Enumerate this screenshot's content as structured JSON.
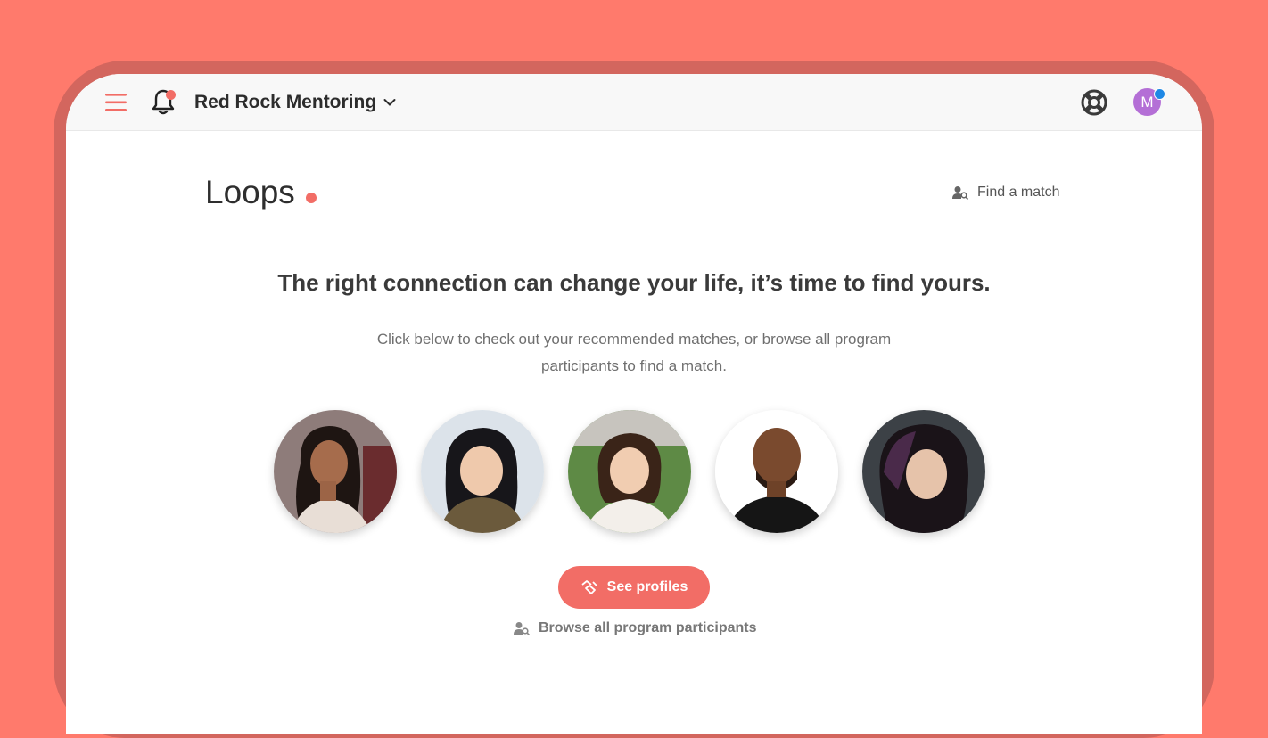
{
  "header": {
    "org_name": "Red Rock Mentoring",
    "avatar_initial": "M"
  },
  "page": {
    "title": "Loops",
    "find_match_label": "Find a match"
  },
  "hero": {
    "headline": "The right connection can change your life, it’s time to find yours.",
    "subtext": "Click below to check out your recommended matches, or browse all program participants to find a match."
  },
  "actions": {
    "see_profiles_label": "See profiles",
    "browse_label": "Browse all program participants"
  },
  "colors": {
    "background": "#FF7A6C",
    "device_frame": "#D3665E",
    "accent": "#F26D66",
    "avatar": "#B46FD6",
    "notification_blue": "#1E88E5"
  },
  "icons": [
    "menu-icon",
    "bell-icon",
    "chevron-down-icon",
    "help-lifebuoy-icon",
    "person-search-icon",
    "hands-icon"
  ]
}
